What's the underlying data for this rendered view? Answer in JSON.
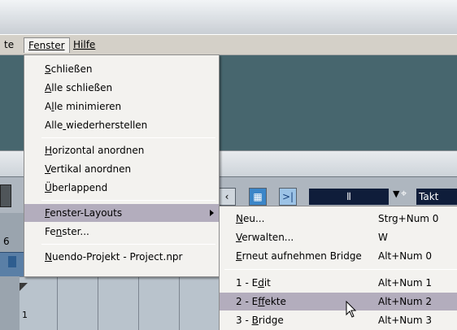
{
  "menubar": {
    "items": [
      {
        "label": "te",
        "mnemonic_index": -1
      },
      {
        "label": "Fenster",
        "mnemonic_index": 0
      },
      {
        "label": "Hilfe",
        "mnemonic_index": 0
      }
    ]
  },
  "toolbar": {
    "left_number": "6",
    "field_value": "⫴",
    "takt_label": "Takt"
  },
  "ruler": {
    "marker": "1"
  },
  "fenster_menu": {
    "groups": [
      [
        {
          "pre": "",
          "mn": "S",
          "post": "chließen"
        },
        {
          "pre": "",
          "mn": "A",
          "post": "lle schließen"
        },
        {
          "pre": "A",
          "mn": "l",
          "post": "le minimieren"
        },
        {
          "pre": "Alle",
          "mn": " ",
          "post": "wiederherstellen"
        }
      ],
      [
        {
          "pre": "",
          "mn": "H",
          "post": "orizontal anordnen"
        },
        {
          "pre": "",
          "mn": "V",
          "post": "ertikal anordnen"
        },
        {
          "pre": "",
          "mn": "Ü",
          "post": "berlappend"
        }
      ],
      [
        {
          "pre": "",
          "mn": "F",
          "post": "enster-Layouts",
          "submenu": true,
          "selected": true
        },
        {
          "pre": "Fe",
          "mn": "n",
          "post": "ster..."
        }
      ],
      [
        {
          "pre": "",
          "mn": "N",
          "post": "uendo-Projekt - Project.npr"
        }
      ]
    ]
  },
  "layouts_submenu": {
    "groups": [
      [
        {
          "pre": "",
          "mn": "N",
          "post": "eu...",
          "shortcut": "Strg+Num 0"
        },
        {
          "pre": "",
          "mn": "V",
          "post": "erwalten...",
          "shortcut": "W"
        },
        {
          "pre": "",
          "mn": "E",
          "post": "rneut aufnehmen Bridge",
          "shortcut": "Alt+Num 0"
        }
      ],
      [
        {
          "pre": "1 - E",
          "mn": "d",
          "post": "it",
          "shortcut": "Alt+Num 1"
        },
        {
          "pre": "2 - E",
          "mn": "f",
          "post": "fekte",
          "shortcut": "Alt+Num 2",
          "selected": true
        },
        {
          "pre": "3 - ",
          "mn": "B",
          "post": "ridge",
          "shortcut": "Alt+Num 3"
        }
      ]
    ]
  },
  "colors": {
    "menu_bg": "#f3f2ef",
    "highlight": "#b3adbd",
    "teal": "#47666e"
  }
}
